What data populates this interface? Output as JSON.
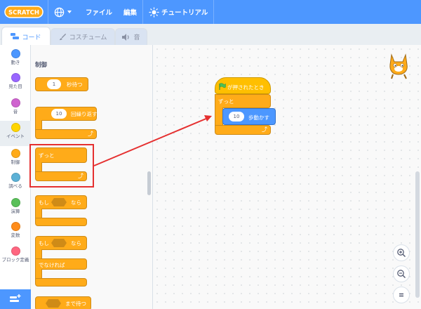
{
  "menu": {
    "logo_text": "SCRATCH",
    "file": "ファイル",
    "edit": "編集",
    "tutorials": "チュートリアル"
  },
  "tabs": {
    "code": "コード",
    "costumes": "コスチューム",
    "sounds": "音"
  },
  "categories": [
    {
      "label": "動き",
      "color": "#4c97ff"
    },
    {
      "label": "見た目",
      "color": "#9966ff"
    },
    {
      "label": "音",
      "color": "#cf63cf"
    },
    {
      "label": "イベント",
      "color": "#ffd500"
    },
    {
      "label": "制御",
      "color": "#ffab19"
    },
    {
      "label": "調べる",
      "color": "#5cb1d6"
    },
    {
      "label": "演算",
      "color": "#59c059"
    },
    {
      "label": "変数",
      "color": "#ff8c1a"
    },
    {
      "label": "ブロック定義",
      "color": "#ff6680"
    }
  ],
  "palette": {
    "section_title": "制御",
    "wait": {
      "value": "1",
      "label": "秒待つ"
    },
    "repeat": {
      "value": "10",
      "label": "回繰り返す"
    },
    "forever": {
      "label": "ずっと"
    },
    "if_then": {
      "if": "もし",
      "then": "なら"
    },
    "if_else": {
      "if": "もし",
      "then": "なら",
      "else": "でなければ"
    },
    "wait_until": {
      "label": "まで待つ"
    }
  },
  "script": {
    "hat": "が押されたとき",
    "forever": "ずっと",
    "move": {
      "value": "10",
      "label": "歩動かす"
    }
  },
  "colors": {
    "menubar": "#4d97ff",
    "control": "#ffab19",
    "motion": "#4c97ff",
    "event": "#ffbf00",
    "highlight": "#e53030"
  }
}
